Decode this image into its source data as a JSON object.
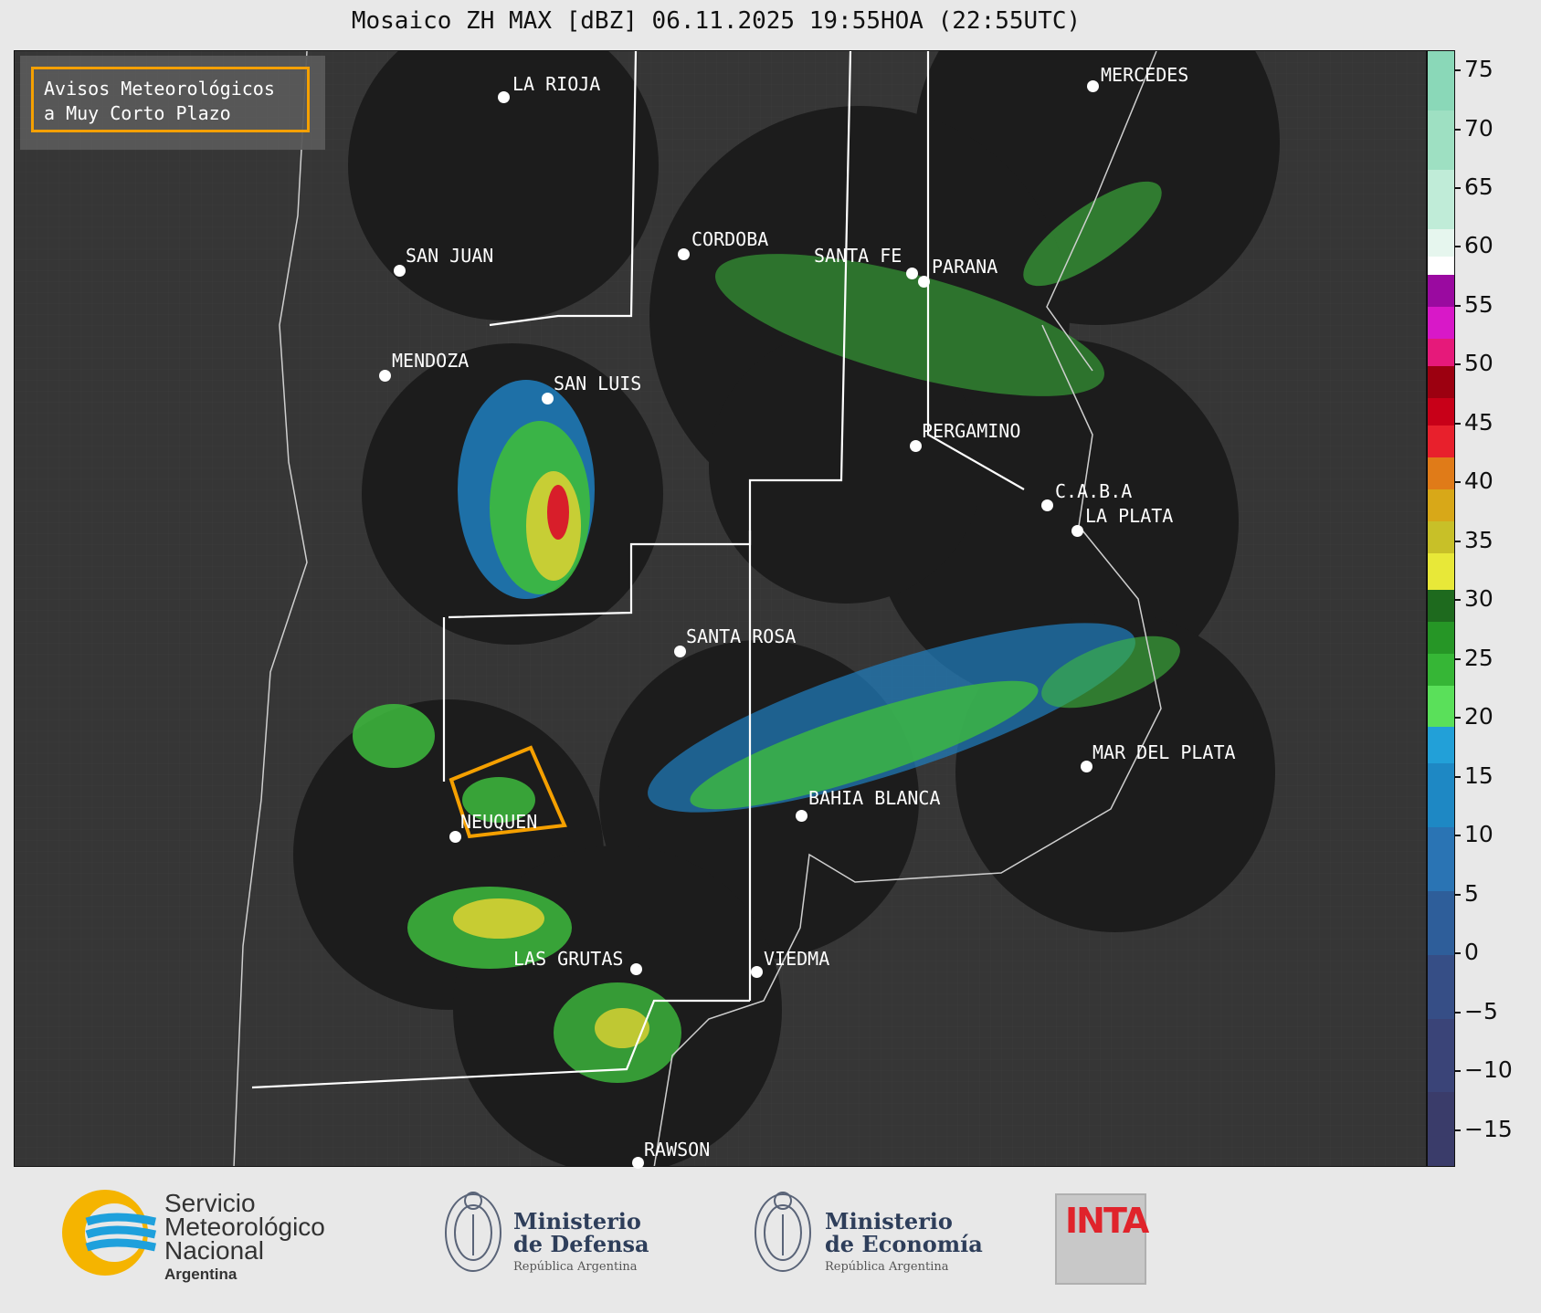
{
  "title": "Mosaico ZH MAX [dBZ] 06.11.2025 19:55HOA (22:55UTC)",
  "avisos": {
    "line1": "Avisos Meteorológicos",
    "line2": "a Muy Corto Plazo",
    "border_color": "#f5a000"
  },
  "cities": [
    {
      "name": "LA RIOJA"
    },
    {
      "name": "MERCEDES"
    },
    {
      "name": "CORDOBA"
    },
    {
      "name": "SAN JUAN"
    },
    {
      "name": "SANTA FE"
    },
    {
      "name": "PARANA"
    },
    {
      "name": "MENDOZA"
    },
    {
      "name": "SAN LUIS"
    },
    {
      "name": "PERGAMINO"
    },
    {
      "name": "C.A.B.A"
    },
    {
      "name": "LA PLATA"
    },
    {
      "name": "SANTA ROSA"
    },
    {
      "name": "MAR DEL PLATA"
    },
    {
      "name": "BAHIA BLANCA"
    },
    {
      "name": "NEUQUEN"
    },
    {
      "name": "LAS GRUTAS"
    },
    {
      "name": "VIEDMA"
    },
    {
      "name": "RAWSON"
    }
  ],
  "colorbar": {
    "label_unit": "dBZ",
    "ticks": [
      "75",
      "70",
      "65",
      "60",
      "55",
      "50",
      "45",
      "40",
      "35",
      "30",
      "25",
      "20",
      "15",
      "10",
      "5",
      "0",
      "−5",
      "−10",
      "−15"
    ],
    "range": [
      -19,
      77
    ]
  },
  "logos": {
    "smn_line1": "Servicio",
    "smn_line2": "Meteorológico",
    "smn_line3": "Nacional",
    "smn_line4": "Argentina",
    "defensa_line1": "Ministerio",
    "defensa_line2": "de Defensa",
    "defensa_line3": "República Argentina",
    "economia_line1": "Ministerio",
    "economia_line2": "de Economía",
    "economia_line3": "República Argentina",
    "inta": "INTA"
  },
  "colors": {
    "background": "#3a3a3a",
    "radar_coverage": "#1c1c1c",
    "boundary": "#ffffff",
    "smn_yellow": "#f5b400",
    "smn_blue": "#1ea0dc"
  }
}
